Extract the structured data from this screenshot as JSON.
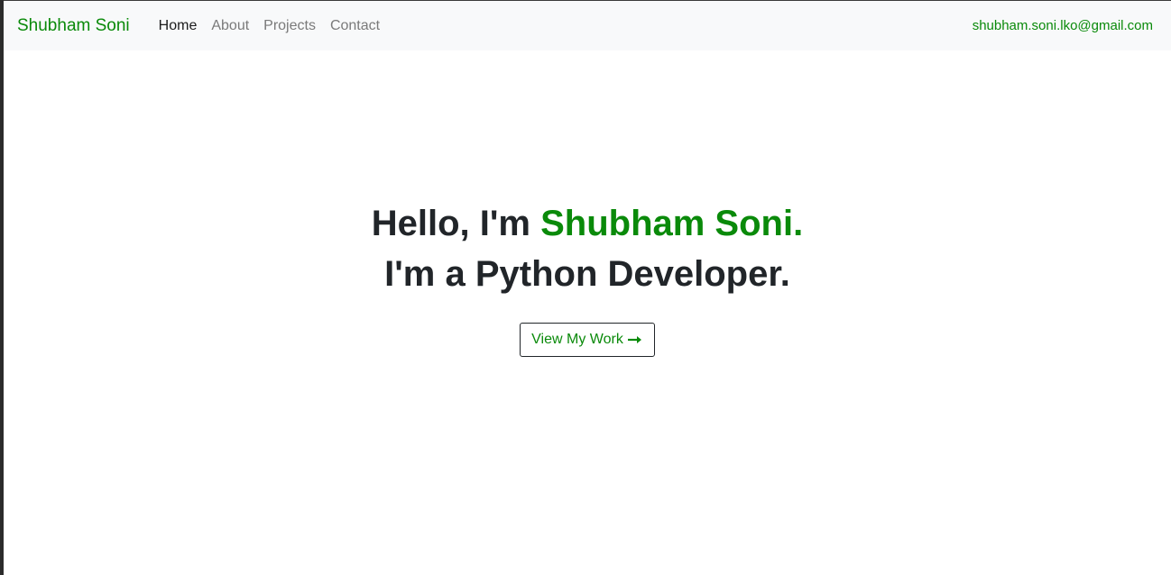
{
  "navbar": {
    "brand": "Shubham Soni",
    "links": [
      {
        "label": "Home",
        "active": true
      },
      {
        "label": "About",
        "active": false
      },
      {
        "label": "Projects",
        "active": false
      },
      {
        "label": "Contact",
        "active": false
      }
    ],
    "email": "shubham.soni.lko@gmail.com"
  },
  "hero": {
    "greeting_prefix": "Hello, I'm ",
    "name": "Shubham Soni.",
    "role_line": "I'm a Python Developer.",
    "cta_label": "View My Work",
    "cta_icon": "arrow-right-icon"
  },
  "colors": {
    "accent": "#0a8a0a",
    "text_dark": "#212529",
    "nav_muted": "#7a7a7a",
    "navbar_bg": "#f8f9fa"
  }
}
